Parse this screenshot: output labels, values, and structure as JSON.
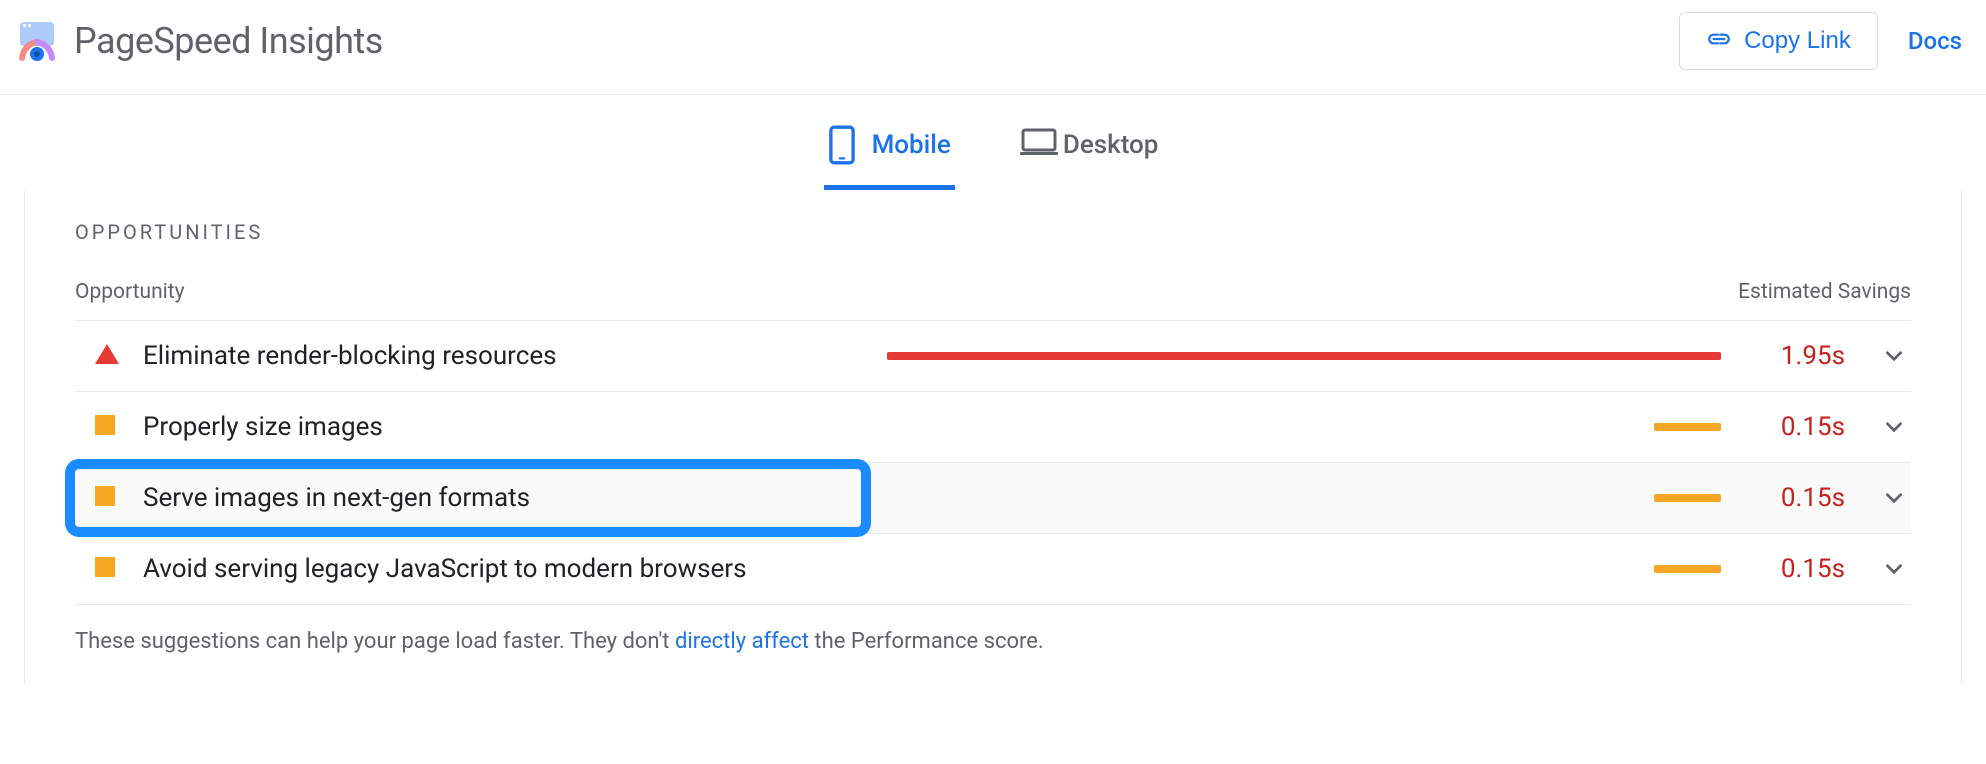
{
  "header": {
    "title": "PageSpeed Insights",
    "copy_link_label": "Copy Link",
    "docs_label": "Docs"
  },
  "tabs": {
    "mobile_label": "Mobile",
    "desktop_label": "Desktop"
  },
  "opportunities": {
    "section_title": "OPPORTUNITIES",
    "col_opportunity": "Opportunity",
    "col_savings": "Estimated Savings",
    "items": [
      {
        "status": "red-triangle",
        "label": "Eliminate render-blocking resources",
        "savings": "1.95s",
        "bar_color": "red",
        "bar_width_pct": 100
      },
      {
        "status": "orange-square",
        "label": "Properly size images",
        "savings": "0.15s",
        "bar_color": "orange",
        "bar_width_pct": 8
      },
      {
        "status": "orange-square",
        "label": "Serve images in next-gen formats",
        "savings": "0.15s",
        "bar_color": "orange",
        "bar_width_pct": 8
      },
      {
        "status": "orange-square",
        "label": "Avoid serving legacy JavaScript to modern browsers",
        "savings": "0.15s",
        "bar_color": "orange",
        "bar_width_pct": 8
      }
    ],
    "footer_prefix": "These suggestions can help your page load faster. They don't ",
    "footer_link": "directly affect",
    "footer_suffix": " the Performance score."
  }
}
